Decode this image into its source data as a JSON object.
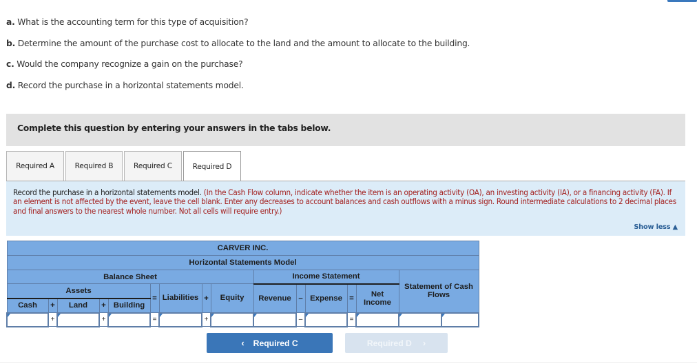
{
  "questions": [
    {
      "letter": "a.",
      "text": " What is the accounting term for this type of acquisition?"
    },
    {
      "letter": "b.",
      "text": " Determine the amount of the purchase cost to allocate to the land and the amount to allocate to the building."
    },
    {
      "letter": "c.",
      "text": " Would the company recognize a gain on the purchase?"
    },
    {
      "letter": "d.",
      "text": " Record the purchase in a horizontal statements model."
    }
  ],
  "instruction_bar": "Complete this question by entering your answers in the tabs below.",
  "tabs": [
    {
      "label": "Required A",
      "active": false
    },
    {
      "label": "Required B",
      "active": false
    },
    {
      "label": "Required C",
      "active": false
    },
    {
      "label": "Required D",
      "active": true
    }
  ],
  "panel": {
    "lead": "Record the purchase in a horizontal statements model. ",
    "note": "(In the Cash Flow column, indicate whether the item is an operating activity (OA), an investing activity (IA), or a financing activity (FA). If an element is not affected by the event, leave the cell blank. Enter any decreases to account balances and cash outflows with a minus sign. Round intermediate calculations to 2 decimal places and final answers to the nearest whole number. Not all cells will require entry.)",
    "show_less": "Show less",
    "show_less_icon": "▲"
  },
  "model": {
    "company": "CARVER INC.",
    "title": "Horizontal Statements Model",
    "balance_sheet": "Balance Sheet",
    "income_statement": "Income Statement",
    "assets": "Assets",
    "cash_flows": "Statement of Cash Flows",
    "columns": {
      "cash": "Cash",
      "land": "Land",
      "building": "Building",
      "liabilities": "Liabilities",
      "equity": "Equity",
      "revenue": "Revenue",
      "expense": "Expense",
      "net_income": "Net Income"
    },
    "operators": {
      "plus": "+",
      "equals": "=",
      "minus": "–"
    },
    "inputs": {
      "cash": "",
      "land": "",
      "building": "",
      "liabilities": "",
      "equity": "",
      "revenue": "",
      "expense": "",
      "net_income": "",
      "cash_flow_amount": "",
      "cash_flow_activity": ""
    }
  },
  "nav": {
    "prev_label": "Required C",
    "prev_icon": "‹",
    "next_label": "Required D",
    "next_icon": "›"
  },
  "colors": {
    "accent": "#3a76b8",
    "header_blue": "#79aae2",
    "panel_bg": "#dcecf8",
    "note_red": "#a3201f"
  }
}
